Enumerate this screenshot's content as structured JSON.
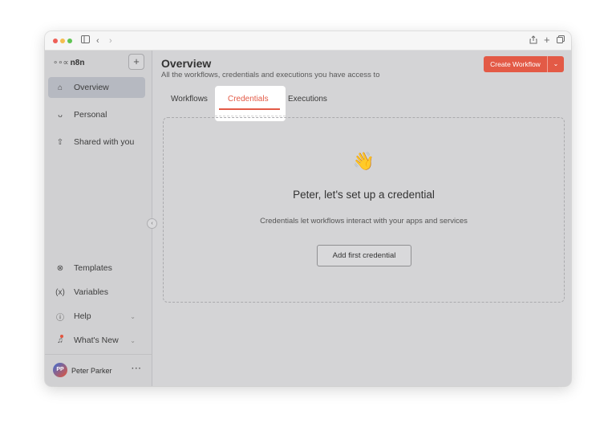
{
  "browser": {
    "icons": {
      "sidebar_toggle": "sidebar-icon",
      "back": "chevron-left-icon",
      "forward": "chevron-right-icon",
      "share": "share-icon",
      "new_tab": "plus-icon",
      "tabs": "copy-icon"
    }
  },
  "sidebar": {
    "logo_text": "n8n",
    "add_label": "+",
    "nav_top": [
      {
        "label": "Overview",
        "icon": "home-icon",
        "active": true
      },
      {
        "label": "Personal",
        "icon": "user-icon"
      },
      {
        "label": "Shared with you",
        "icon": "share-icon"
      }
    ],
    "nav_bottom": [
      {
        "label": "Templates",
        "icon": "box-icon"
      },
      {
        "label": "Variables",
        "icon": "variables-icon"
      },
      {
        "label": "Help",
        "icon": "help-icon"
      },
      {
        "label": "What's New",
        "icon": "bell-icon"
      }
    ],
    "user": {
      "initials": "PP",
      "name": "Peter Parker",
      "menu": "···"
    }
  },
  "header": {
    "title": "Overview",
    "subtitle": "All the workflows, credentials and executions you have access to",
    "create_button": "Create Workflow"
  },
  "tabs": [
    {
      "label": "Workflows"
    },
    {
      "label": "Credentials",
      "active": true
    },
    {
      "label": "Executions"
    }
  ],
  "empty_state": {
    "emoji": "👋",
    "title": "Peter, let's set up a credential",
    "description": "Credentials let workflows interact with your apps and services",
    "button": "Add first credential"
  },
  "colors": {
    "accent": "#e35a46",
    "sidebar_active": "#b6b9c1",
    "background": "#d4d4d6"
  }
}
